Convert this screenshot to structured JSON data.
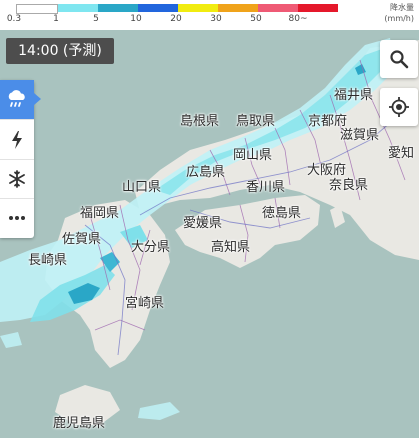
{
  "legend": {
    "colors": [
      "#ffffff",
      "#7fe6f0",
      "#2aa7c7",
      "#2266dd",
      "#f1ec10",
      "#f0a31a",
      "#ef5a75",
      "#e5182b",
      "#8a1d8c"
    ],
    "ticks": [
      "0.3",
      "1",
      "5",
      "10",
      "20",
      "30",
      "50",
      "80~"
    ],
    "unit_line1": "降水量",
    "unit_line2": "(mm/h)"
  },
  "time_badge": "14:00 (予測)",
  "layers": [
    {
      "icon": "rain-cloud-icon"
    },
    {
      "icon": "lightning-icon"
    },
    {
      "icon": "snowflake-icon"
    },
    {
      "icon": "more-dots-icon"
    }
  ],
  "controls": [
    {
      "icon": "search-icon"
    },
    {
      "icon": "current-location-icon"
    }
  ],
  "places": {
    "fukui": "福井県",
    "shimane": "島根県",
    "tottori": "鳥取県",
    "kyoto": "京都府",
    "shiga": "滋賀県",
    "okayama": "岡山県",
    "aichi": "愛知",
    "hiroshima": "広島県",
    "osaka": "大阪府",
    "yamaguchi": "山口県",
    "kagawa": "香川県",
    "nara": "奈良県",
    "fukuoka": "福岡県",
    "ehime": "愛媛県",
    "tokushima": "徳島県",
    "saga": "佐賀県",
    "oita": "大分県",
    "kochi": "高知県",
    "nagasaki": "長崎県",
    "miyazaki": "宮崎県",
    "kagoshima": "鹿児島県"
  }
}
